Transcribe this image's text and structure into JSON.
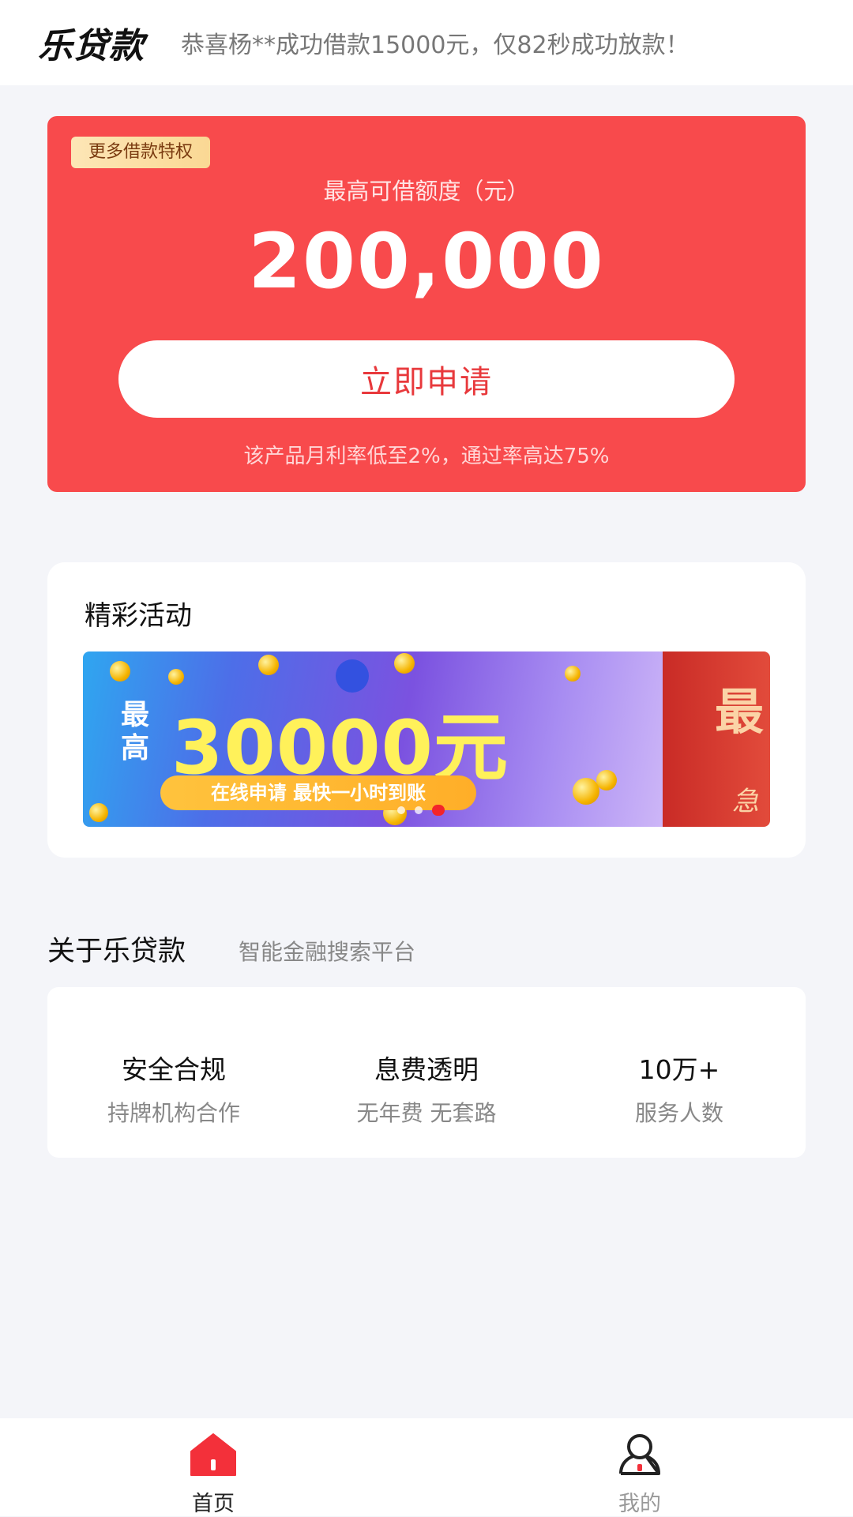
{
  "header": {
    "logo": "乐贷款",
    "ticker": "恭喜杨**成功借款15000元，仅82秒成功放款！"
  },
  "quota": {
    "badge": "更多借款特权",
    "label": "最高可借额度（元）",
    "amount": "200,000",
    "apply_label": "立即申请",
    "note": "该产品月利率低至2%，通过率高达75%"
  },
  "activity": {
    "title": "精彩活动",
    "banner": {
      "prefix": "最高",
      "amount": "30000元",
      "pill": "在线申请 最快一小时到账",
      "next_text": "最",
      "next_sub": "急"
    }
  },
  "about": {
    "title": "关于乐贷款",
    "subtitle": "智能金融搜索平台",
    "features": [
      {
        "title": "安全合规",
        "desc": "持牌机构合作"
      },
      {
        "title": "息费透明",
        "desc": "无年费 无套路"
      },
      {
        "title": "10万+",
        "desc": "服务人数"
      }
    ]
  },
  "tabbar": {
    "home": "首页",
    "mine": "我的"
  },
  "colors": {
    "brand_red": "#f84a4c",
    "background": "#f4f5f9"
  }
}
